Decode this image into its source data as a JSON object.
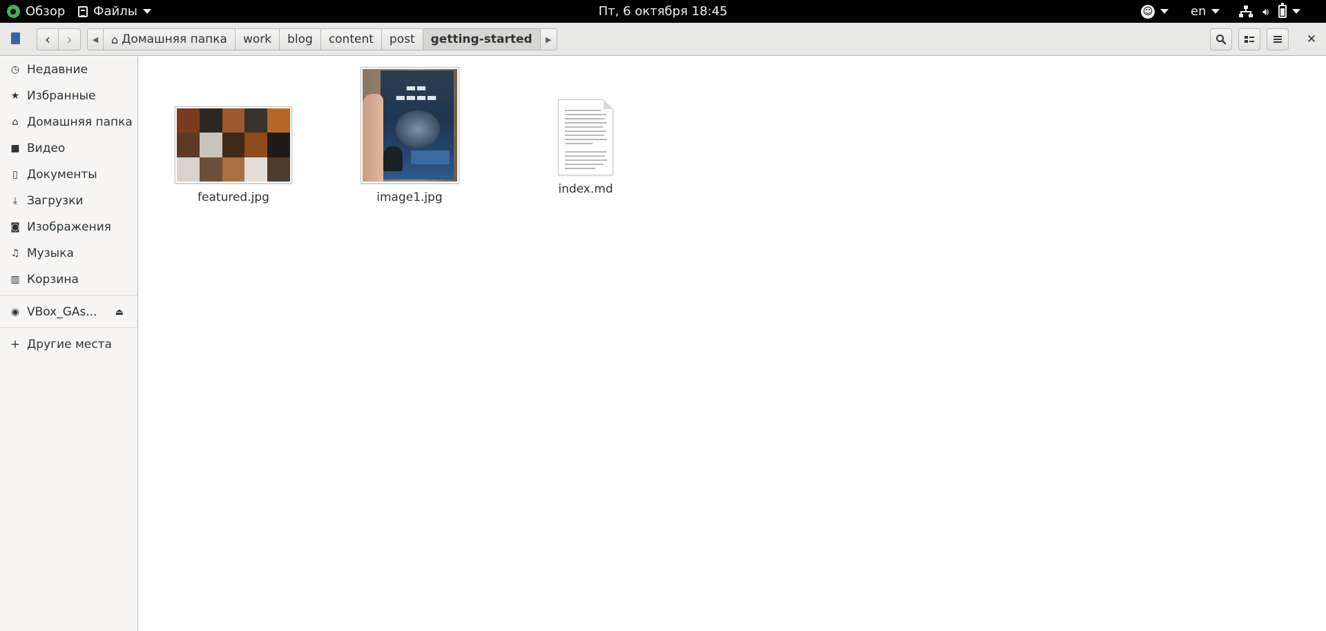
{
  "topbar": {
    "activities_label": "Обзор",
    "app_menu_label": "Файлы",
    "clock": "Пт, 6 октября  18:45",
    "language": "en",
    "icons": [
      "accessibility-icon",
      "network-icon",
      "volume-icon",
      "battery-icon"
    ]
  },
  "headerbar": {
    "path": [
      {
        "label": "Домашняя папка",
        "icon": "home-icon"
      },
      {
        "label": "work"
      },
      {
        "label": "blog"
      },
      {
        "label": "content"
      },
      {
        "label": "post"
      },
      {
        "label": "getting-started",
        "active": true
      }
    ],
    "buttons": [
      "back-icon",
      "forward-icon",
      "search-icon",
      "view-options-icon",
      "menu-icon",
      "close-icon"
    ]
  },
  "sidebar": {
    "items": [
      {
        "label": "Недавние",
        "icon": "recent-icon"
      },
      {
        "label": "Избранные",
        "icon": "star-icon"
      },
      {
        "label": "Домашняя папка",
        "icon": "home-icon"
      },
      {
        "label": "Видео",
        "icon": "video-icon"
      },
      {
        "label": "Документы",
        "icon": "document-icon"
      },
      {
        "label": "Загрузки",
        "icon": "download-icon"
      },
      {
        "label": "Изображения",
        "icon": "camera-icon"
      },
      {
        "label": "Музыка",
        "icon": "music-icon"
      },
      {
        "label": "Корзина",
        "icon": "trash-icon"
      }
    ],
    "devices": [
      {
        "label": "VBox_GAs...",
        "icon": "disc-icon",
        "action_icon": "eject-icon"
      }
    ],
    "other": {
      "label": "Другие места",
      "icon": "plus-icon"
    }
  },
  "files": [
    {
      "name": "featured.jpg",
      "type": "image"
    },
    {
      "name": "image1.jpg",
      "type": "image"
    },
    {
      "name": "index.md",
      "type": "text"
    }
  ],
  "colors": {
    "topbar_bg": "#000000",
    "headerbar_bg": "#e8e8e7",
    "sidebar_bg": "#f6f5f4",
    "accent": "#3465a4"
  }
}
